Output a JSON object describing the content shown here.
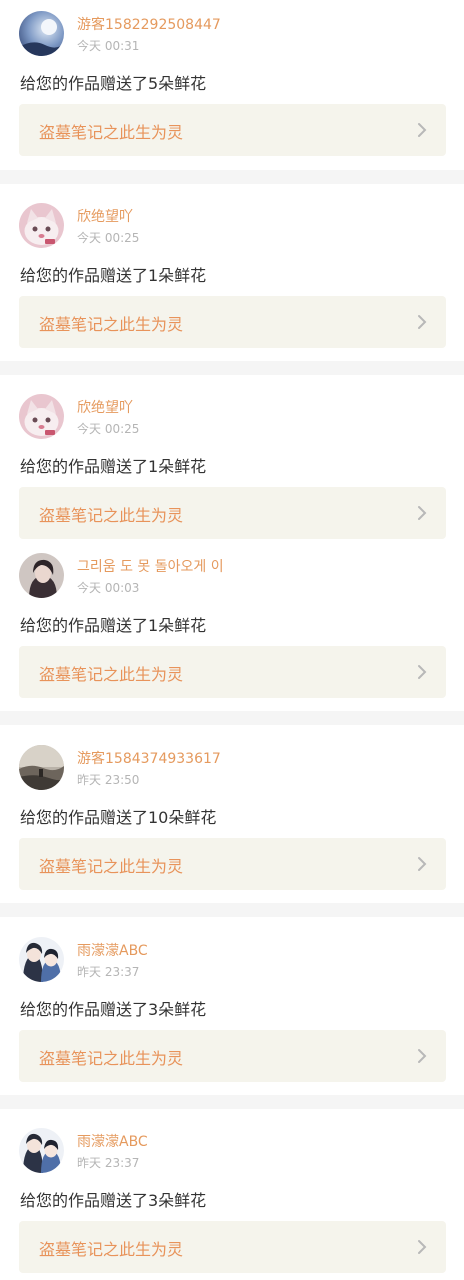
{
  "feed": {
    "items": [
      {
        "username": "游客1582292508447",
        "time": "今天 00:31",
        "message": "给您的作品赠送了5朵鲜花",
        "work_title": "盗墓笔记之此生为灵",
        "avatar_icon": "moon-night-avatar-icon"
      },
      {
        "username": "欣绝望吖",
        "time": "今天 00:25",
        "message": "给您的作品赠送了1朵鲜花",
        "work_title": "盗墓笔记之此生为灵",
        "avatar_icon": "cat-avatar-icon"
      },
      {
        "username": "欣绝望吖",
        "time": "今天 00:25",
        "message": "给您的作品赠送了1朵鲜花",
        "work_title": "盗墓笔记之此生为灵",
        "avatar_icon": "cat-avatar-icon"
      },
      {
        "username": "그리움 도 못 돌아오게 이",
        "time": "今天 00:03",
        "message": "给您的作品赠送了1朵鲜花",
        "work_title": "盗墓笔记之此生为灵",
        "avatar_icon": "person-avatar-icon"
      },
      {
        "username": "游客1584374933617",
        "time": "昨天 23:50",
        "message": "给您的作品赠送了10朵鲜花",
        "work_title": "盗墓笔记之此生为灵",
        "avatar_icon": "landscape-avatar-icon"
      },
      {
        "username": "雨濛濛ABC",
        "time": "昨天 23:37",
        "message": "给您的作品赠送了3朵鲜花",
        "work_title": "盗墓笔记之此生为灵",
        "avatar_icon": "anime-couple-avatar-icon"
      },
      {
        "username": "雨濛濛ABC",
        "time": "昨天 23:37",
        "message": "给您的作品赠送了3朵鲜花",
        "work_title": "盗墓笔记之此生为灵",
        "avatar_icon": "anime-couple-avatar-icon"
      }
    ]
  },
  "colors": {
    "username": "#e59a5e",
    "work_title": "#e8935a",
    "card_background": "#f5f4ec",
    "divider": "#f5f5f5",
    "message_text": "#333333",
    "time_text": "#b5b5b5"
  }
}
